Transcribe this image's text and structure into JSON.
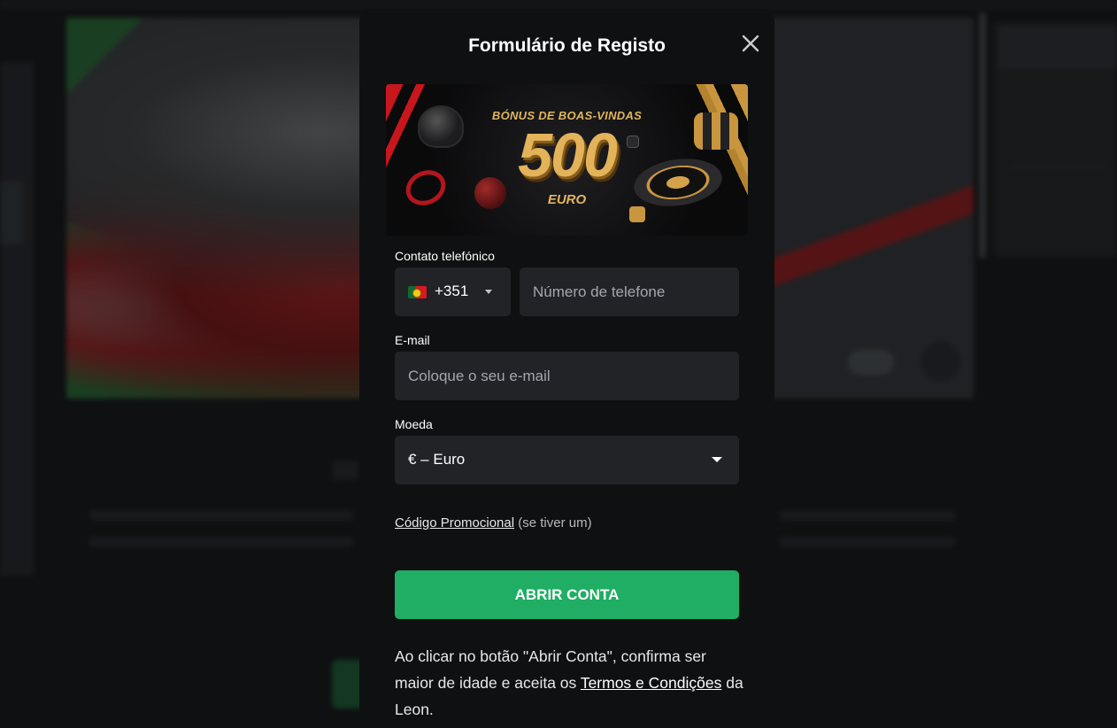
{
  "modal": {
    "title": "Formulário de Registo"
  },
  "promo_banner": {
    "subtitle": "BÓNUS DE BOAS-VINDAS",
    "amount": "500",
    "currency": "EURO"
  },
  "phone": {
    "label": "Contato telefónico",
    "country_code": "+351",
    "country_flag": "portugal-flag-icon",
    "placeholder": "Número de telefone"
  },
  "email": {
    "label": "E-mail",
    "placeholder": "Coloque o seu e-mail"
  },
  "currency": {
    "label": "Moeda",
    "selected": "€ – Euro"
  },
  "promo_code": {
    "link_text": "Código Promocional",
    "hint": " (se tiver um)"
  },
  "submit": {
    "label": "ABRIR CONTA"
  },
  "disclaimer": {
    "before": "Ao clicar no botão \"Abrir Conta\", confirma ser maior de idade e aceita os ",
    "terms_link": "Termos e Condições",
    "after": " da Leon."
  },
  "colors": {
    "modal_background": "#0f1011",
    "field_background": "#212327",
    "accent_green": "#1fae64",
    "promo_gold": "#e3b35a",
    "promo_red": "#c8161d"
  }
}
